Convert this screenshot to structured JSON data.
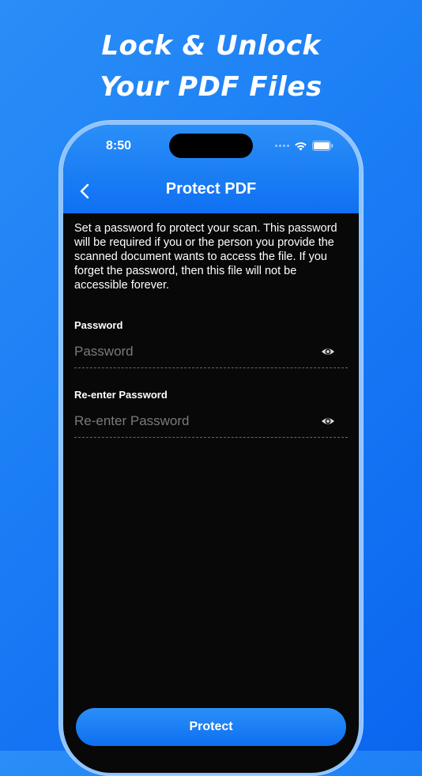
{
  "promo": {
    "headline_line1": "Lock & Unlock",
    "headline_line2": "Your PDF Files"
  },
  "status_bar": {
    "time": "8:50",
    "icons": [
      "cellular-dots-icon",
      "wifi-icon",
      "battery-icon"
    ]
  },
  "nav": {
    "back_icon": "chevron-left-icon",
    "title": "Protect PDF"
  },
  "description": "Set a password fo protect your scan. This password will be required if you or the person you provide the scanned document wants to access the file. If you forget the password, then this file will not be accessible forever.",
  "fields": [
    {
      "label": "Password",
      "placeholder": "Password",
      "value": "",
      "icon": "eye-icon"
    },
    {
      "label": "Re-enter Password",
      "placeholder": "Re-enter Password",
      "value": "",
      "icon": "eye-icon"
    }
  ],
  "actions": {
    "protect_label": "Protect"
  },
  "colors": {
    "accent": "#1a7df5",
    "screen_bg": "#080808",
    "text": "#ffffff",
    "placeholder": "#7a7a7a"
  }
}
